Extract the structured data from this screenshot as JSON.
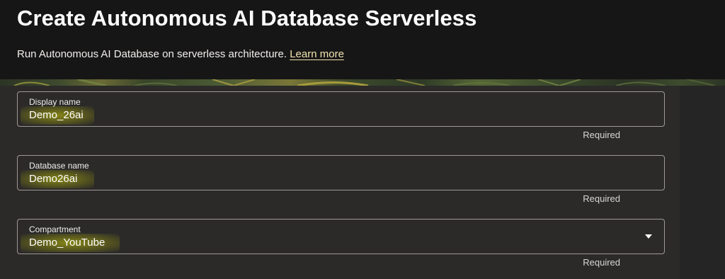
{
  "header": {
    "title": "Create Autonomous AI Database Serverless",
    "subtitle": "Run Autonomous AI Database on serverless architecture.",
    "learn_more": "Learn more"
  },
  "fields": {
    "display_name": {
      "label": "Display name",
      "value": "Demo_26ai",
      "hint": "Required"
    },
    "database_name": {
      "label": "Database name",
      "value": "Demo26ai",
      "hint": "Required"
    },
    "compartment": {
      "label": "Compartment",
      "value": "Demo_YouTube",
      "hint": "Required",
      "icon": "chevron-down-icon"
    }
  },
  "colors": {
    "header_bg": "#171616",
    "panel_bg": "#2b2a29",
    "border": "#9e9a95",
    "link": "#f1e3b0",
    "highlight": "#ffff00"
  }
}
